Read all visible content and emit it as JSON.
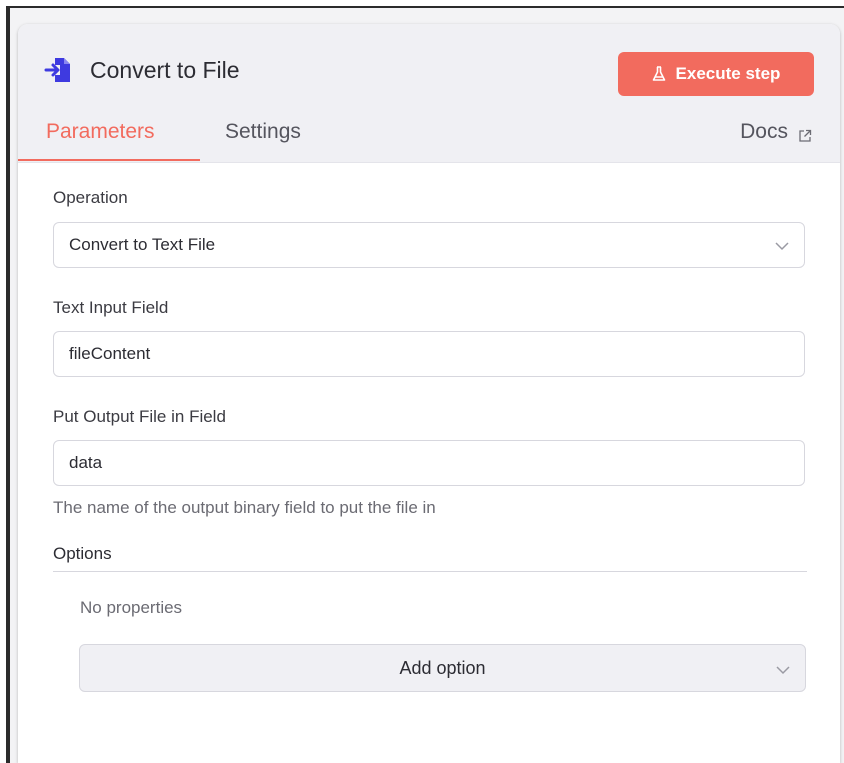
{
  "node": {
    "title": "Convert to File",
    "icon": "convert-to-file-icon",
    "icon_color": "#3e3ae0"
  },
  "header": {
    "execute_label": "Execute step",
    "execute_icon": "flask-icon",
    "accent_color": "#f26b5e"
  },
  "tabs": [
    {
      "label": "Parameters",
      "active": true
    },
    {
      "label": "Settings",
      "active": false
    }
  ],
  "docs": {
    "label": "Docs",
    "icon": "external-link-icon"
  },
  "fields": {
    "operation": {
      "label": "Operation",
      "value": "Convert to Text File",
      "icon": "chevron-down-icon"
    },
    "text_input": {
      "label": "Text Input Field",
      "value": "fileContent"
    },
    "output_field": {
      "label": "Put Output File in Field",
      "value": "data",
      "hint": "The name of the output binary field to put the file in"
    }
  },
  "options": {
    "title": "Options",
    "empty_text": "No properties",
    "add_label": "Add option"
  }
}
